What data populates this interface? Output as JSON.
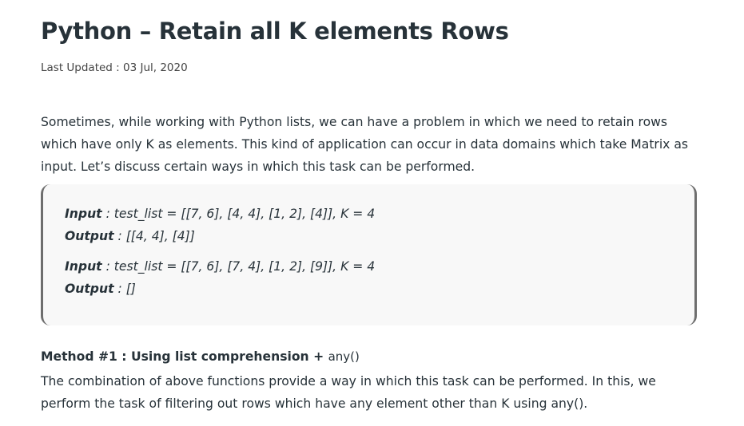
{
  "article": {
    "title": "Python – Retain all K elements Rows",
    "last_updated": "Last Updated : 03 Jul, 2020",
    "intro": "Sometimes, while working with Python lists, we can have a problem in which we need to retain rows which have only K as elements. This kind of application can occur in data domains which take Matrix as input. Let’s discuss certain ways in which this task can be performed."
  },
  "examples": [
    {
      "label": "Input",
      "text": " : test_list = [[7, 6], [4, 4], [1, 2], [4]], K = 4"
    },
    {
      "label": "Output",
      "text": " : [[4, 4], [4]]"
    },
    {
      "label": "Input",
      "text": " : test_list = [[7, 6], [7, 4], [1, 2], [9]], K = 4"
    },
    {
      "label": "Output",
      "text": " : []"
    }
  ],
  "method": {
    "heading": "Method #1 : Using list comprehension + ",
    "heading_code": "any()",
    "text_before": "The combination of above functions provide a way in which this task can be performed. In this, we perform the task of filtering out rows which have any element other than K using ",
    "text_code": "any()",
    "text_after": "."
  }
}
